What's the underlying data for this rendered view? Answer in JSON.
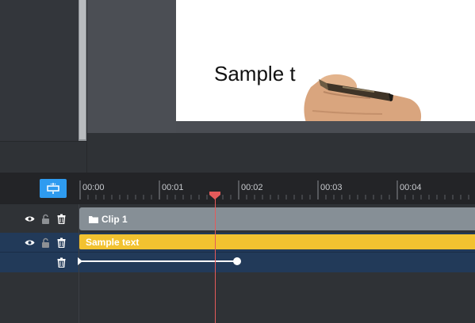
{
  "canvas": {
    "sample_text": "Sample t"
  },
  "timeline": {
    "ticks": [
      "00:00",
      "00:01",
      "00:02",
      "00:03",
      "00:04"
    ]
  },
  "tracks": {
    "clip1_label": "Clip 1",
    "text_clip_label": "Sample text"
  },
  "colors": {
    "accent": "#2e9bf0",
    "playhead": "#e45a5a",
    "clip_gray": "#868f96",
    "text_clip": "#f2c230",
    "selected_row": "#223a59"
  },
  "icons": [
    "fit-to-screen-icon",
    "eye-icon",
    "lock-icon",
    "trash-icon",
    "folder-icon"
  ]
}
